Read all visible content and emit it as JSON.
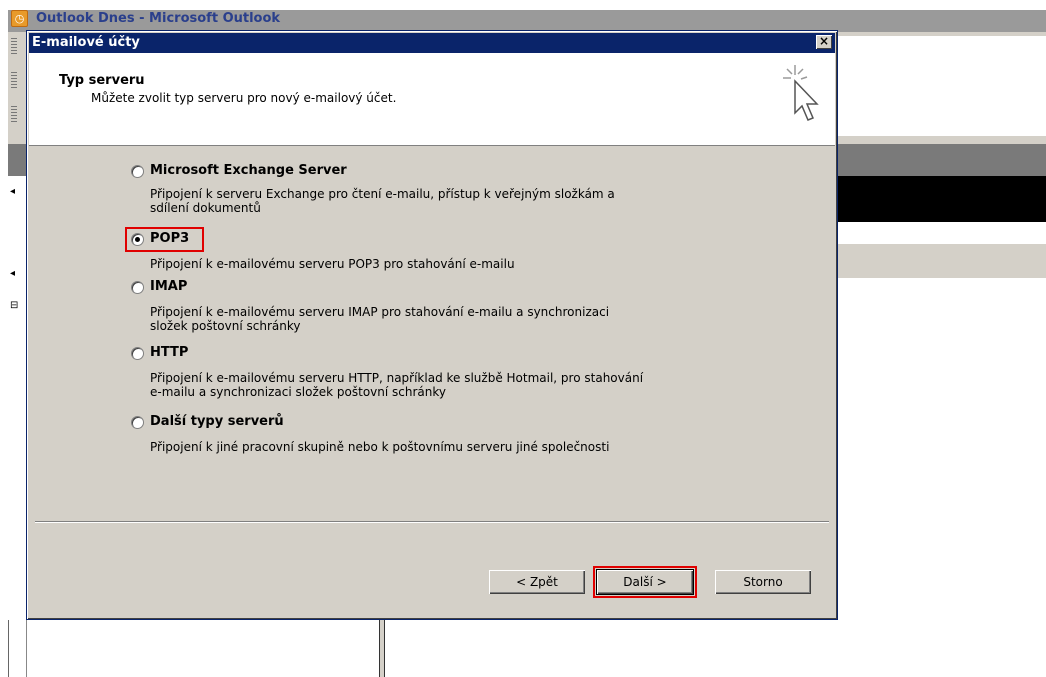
{
  "background_window": {
    "title": "Outlook Dnes - Microsoft Outlook"
  },
  "dialog": {
    "title": "E-mailové účty",
    "close_label": "×",
    "header": {
      "title": "Typ serveru",
      "subtitle": "Můžete zvolit typ serveru pro nový e-mailový účet."
    },
    "options": [
      {
        "label": "Microsoft Exchange Server",
        "description_lines": [
          "Připojení k serveru Exchange pro čtení e-mailu, přístup k veřejným složkám a",
          "sdílení dokumentů"
        ],
        "selected": false
      },
      {
        "label": "POP3",
        "description_lines": [
          "Připojení k e-mailovému serveru POP3 pro stahování e-mailu"
        ],
        "selected": true
      },
      {
        "label": "IMAP",
        "description_lines": [
          "Připojení k e-mailovému serveru IMAP pro stahování e-mailu a synchronizaci",
          "složek poštovní schránky"
        ],
        "selected": false
      },
      {
        "label": "HTTP",
        "description_lines": [
          "Připojení k e-mailovému serveru HTTP, například ke službě Hotmail, pro stahování",
          "e-mailu a synchronizaci složek poštovní schránky"
        ],
        "selected": false
      },
      {
        "label": "Další typy serverů",
        "description_lines": [
          "Připojení k jiné pracovní skupině nebo k poštovnímu serveru jiné společnosti"
        ],
        "selected": false
      }
    ],
    "buttons": {
      "back": "< Zpět",
      "next": "Další >",
      "cancel": "Storno"
    }
  },
  "colors": {
    "highlight": "#e00000",
    "dialog_title_bg": "#0a246a",
    "dialog_bg": "#d4d0c8"
  }
}
